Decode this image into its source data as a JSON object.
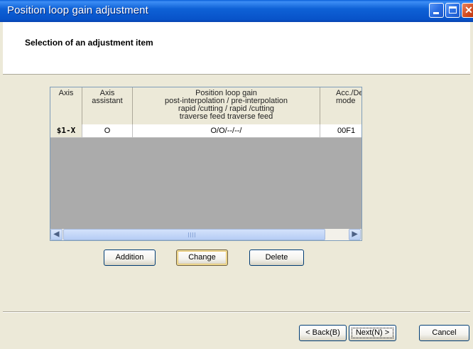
{
  "window": {
    "title": "Position loop gain adjustment"
  },
  "header": {
    "subtitle": "Selection of an adjustment item"
  },
  "grid": {
    "columns": {
      "axis": "Axis",
      "axis_assistant_1": "Axis",
      "axis_assistant_2": "assistant",
      "gain_1": "Position loop gain",
      "gain_2": "post-interpolation / pre-interpolation",
      "gain_3": "rapid   /cutting / rapid   /cutting",
      "gain_4": "traverse  feed     traverse  feed",
      "acc_1": "Acc./De",
      "acc_2": "mode"
    },
    "rows": [
      {
        "axis": "$1-X",
        "assistant": "O",
        "gain": "O/O/--/--/",
        "acc": "00F1"
      }
    ]
  },
  "actions": {
    "addition": "Addition",
    "change": "Change",
    "delete": "Delete"
  },
  "footer": {
    "back": "< Back(B)",
    "next": "Next(N) >",
    "cancel": "Cancel"
  },
  "icons": {
    "minimize": "minimize-icon",
    "maximize": "maximize-icon",
    "close": "close-icon",
    "scroll_left": "chevron-left-icon",
    "scroll_right": "chevron-right-icon"
  }
}
